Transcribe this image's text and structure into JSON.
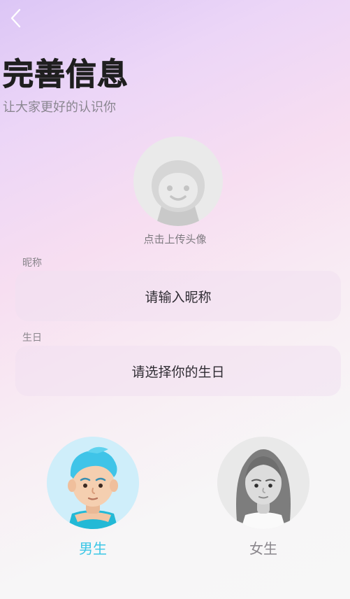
{
  "header": {
    "title": "完善信息",
    "subtitle": "让大家更好的认识你"
  },
  "avatar": {
    "hint": "点击上传头像"
  },
  "nickname": {
    "label": "昵称",
    "placeholder": "请输入昵称"
  },
  "birthday": {
    "label": "生日",
    "placeholder": "请选择你的生日"
  },
  "gender": {
    "male_label": "男生",
    "female_label": "女生",
    "selected": "男生"
  },
  "colors": {
    "accent": "#3bc6e6",
    "muted_text": "#8a868c"
  },
  "icons": {
    "back": "chevron-left-icon",
    "avatar_placeholder": "face-icon"
  }
}
